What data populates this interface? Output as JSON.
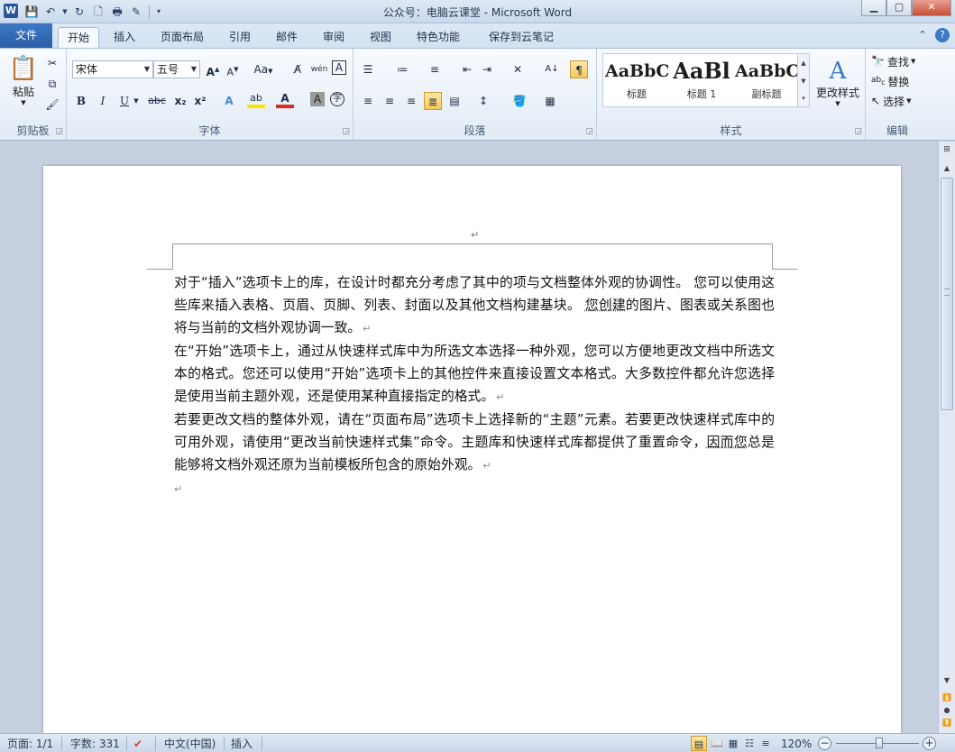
{
  "window": {
    "title": "公众号：电脑云课堂  -  Microsoft Word",
    "app_icon": "W"
  },
  "qat": {
    "icons": [
      "save-icon",
      "undo-icon",
      "redo-icon",
      "new-doc-icon",
      "print-preview-icon",
      "spelling-icon",
      "customize-icon"
    ]
  },
  "tabs": {
    "file": "文件",
    "items": [
      "开始",
      "插入",
      "页面布局",
      "引用",
      "邮件",
      "审阅",
      "视图",
      "特色功能",
      "保存到云笔记"
    ]
  },
  "ribbon": {
    "clipboard": {
      "paste": "粘贴",
      "label": "剪贴板"
    },
    "font": {
      "font_name": "宋体",
      "font_size": "五号",
      "grow": "A",
      "shrink": "A",
      "case": "Aa",
      "bold": "B",
      "italic": "I",
      "underline": "U",
      "strike": "abc",
      "subscript": "x₂",
      "superscript": "x²",
      "label": "字体"
    },
    "paragraph": {
      "label": "段落"
    },
    "styles": {
      "items": [
        {
          "sample": "AaBbC",
          "name": "标题"
        },
        {
          "sample": "AaBl",
          "name": "标题 1"
        },
        {
          "sample": "AaBbC",
          "name": "副标题"
        }
      ],
      "change_styles": "更改样式",
      "label": "样式"
    },
    "editing": {
      "find": "查找",
      "replace": "替换",
      "select": "选择",
      "label": "编辑"
    }
  },
  "document": {
    "paragraphs": [
      {
        "before": "对于“插入”选项卡上的库，在设计时都充分考虑了其中的项与文档整体外观的协调性。 您可以使用这些库来插入表格、页眉、页脚、列表、封面以及其他文档构建基块。 ",
        "marked": "您创建",
        "after": "的图片、图表或关系图也将与当前的文档外观协调一致。"
      },
      {
        "before": "在“开始”选项卡上，通过从快速样式库中为所选文本选择一种外观，您可以方便地更改文档中所选文本的格式。您还可以使用“开始”选项卡上的其他控件来直接设置文本格式。大多数控件都允许您选择是使用当前主题外观，还是使用某种直接指定的格式。",
        "marked": "",
        "after": ""
      },
      {
        "before": "若要更改文档的整体外观，请在“页面布局”选项卡上选择新的“主题”元素。若要更改快速样式库中的可用外观，请使用“更改当前快速样式集”命令。主题库和快速样式库都提供了重置命令，",
        "marked": "因而您",
        "after": "总是能够将文档外观还原为当前模板所包含的原始外观。"
      }
    ],
    "para_mark": "↵"
  },
  "status": {
    "page": "页面: 1/1",
    "words": "字数: 331",
    "language": "中文(中国)",
    "mode": "插入",
    "zoom": "120%",
    "zoom_fraction": 0.52
  },
  "colors": {
    "accent": "#2b579a",
    "file_tab": "#2a5ea8",
    "ribbon_bg": "#e2ebf6"
  }
}
